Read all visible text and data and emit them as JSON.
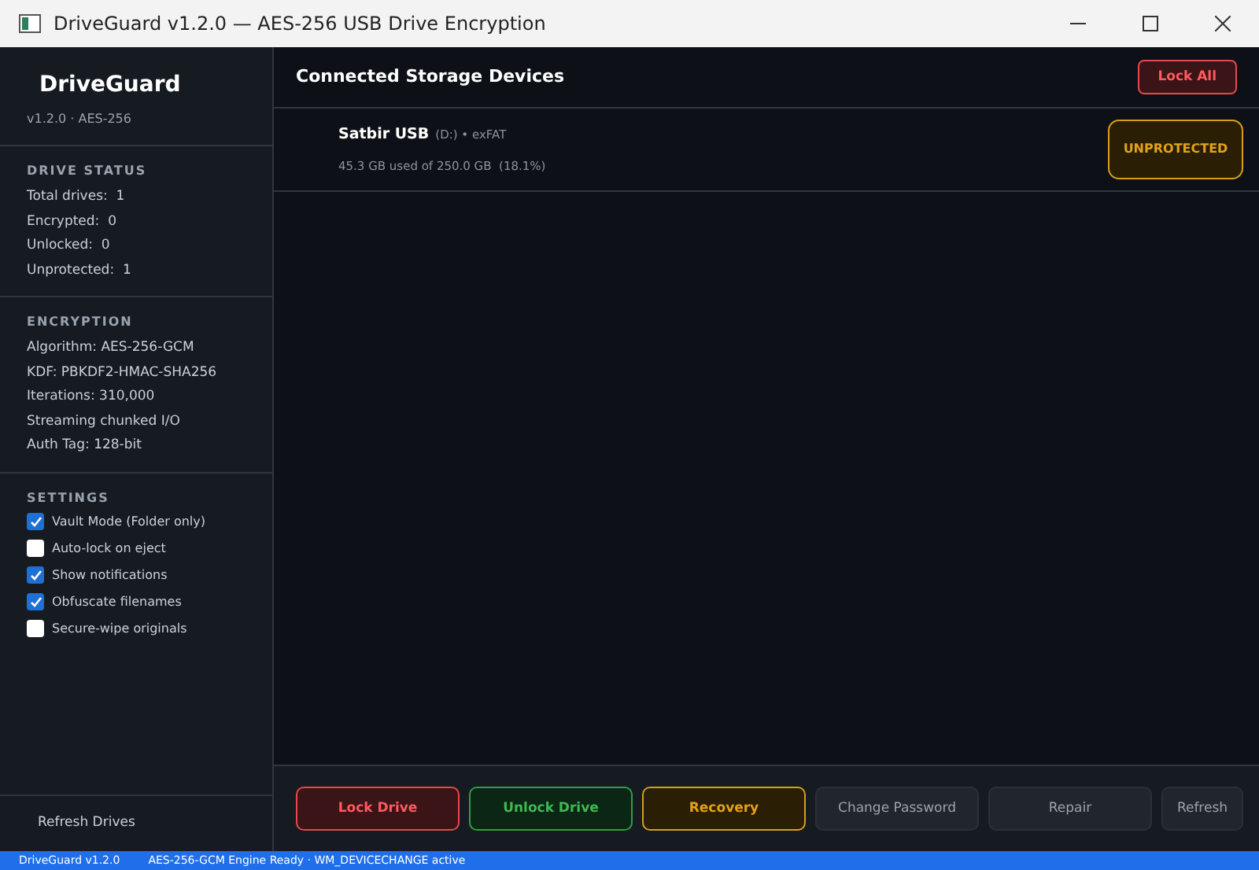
{
  "window": {
    "title": "DriveGuard v1.2.0  —  AES-256 USB Drive Encryption"
  },
  "sidebar": {
    "app_name": "DriveGuard",
    "subtitle": "v1.2.0 · AES-256",
    "sections": [
      {
        "heading": "DRIVE STATUS",
        "lines": [
          "Total drives:  1",
          "Encrypted:  0",
          "Unlocked:  0",
          "Unprotected:  1"
        ]
      },
      {
        "heading": "ENCRYPTION",
        "lines": [
          "Algorithm: AES-256-GCM",
          "KDF: PBKDF2-HMAC-SHA256",
          "Iterations: 310,000",
          "Streaming chunked I/O",
          "Auth Tag: 128-bit"
        ]
      }
    ],
    "settings": {
      "heading": "SETTINGS",
      "options": [
        {
          "label": "Vault Mode (Folder only)",
          "checked": true
        },
        {
          "label": "Auto-lock on eject",
          "checked": false
        },
        {
          "label": "Show notifications",
          "checked": true
        },
        {
          "label": "Obfuscate filenames",
          "checked": true
        },
        {
          "label": "Secure-wipe originals",
          "checked": false
        }
      ]
    },
    "refresh_button": "Refresh Drives"
  },
  "main": {
    "title": "Connected Storage Devices",
    "lock_all": "Lock All",
    "devices": [
      {
        "name": "Satbir USB",
        "meta": "(D:) • exFAT",
        "usage": "45.3 GB used of 250.0 GB  (18.1%)",
        "status": "UNPROTECTED",
        "kind": "unprotected"
      }
    ]
  },
  "actions": [
    {
      "label": "Lock Drive",
      "kind": "danger"
    },
    {
      "label": "Unlock Drive",
      "kind": "success"
    },
    {
      "label": "Recovery",
      "kind": "warning"
    },
    {
      "label": "Change Password",
      "kind": "neutral"
    },
    {
      "label": "Repair",
      "kind": "neutral"
    },
    {
      "label": "Refresh",
      "kind": "neutral"
    }
  ],
  "status_bar": [
    "DriveGuard v1.2.0",
    "AES-256-GCM Engine Ready · WM_DEVICECHANGE active"
  ]
}
